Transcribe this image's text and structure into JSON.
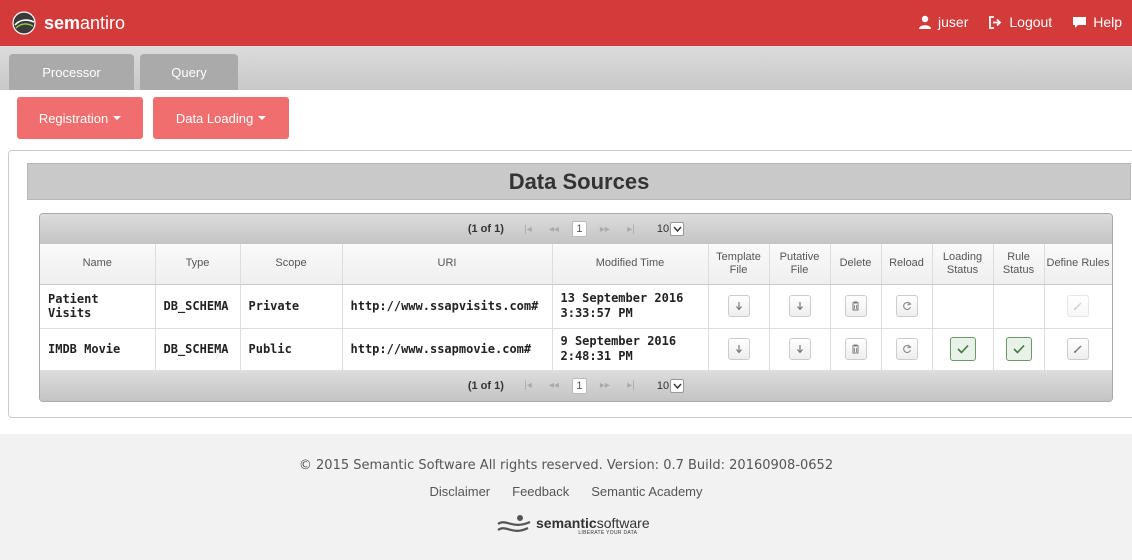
{
  "header": {
    "brand_bold": "sem",
    "brand_rest": "antiro",
    "user_label": "juser",
    "logout_label": "Logout",
    "help_label": "Help",
    "bar_color": "#d33a3a"
  },
  "tabs": [
    {
      "label": "Processor"
    },
    {
      "label": "Query"
    }
  ],
  "menus": [
    {
      "label": "Registration"
    },
    {
      "label": "Data Loading"
    }
  ],
  "panel": {
    "title": "Data Sources"
  },
  "paginator": {
    "report": "(1 of 1)",
    "current_page": "1",
    "rows_per_page": "10"
  },
  "table": {
    "columns": [
      "Name",
      "Type",
      "Scope",
      "URI",
      "Modified Time",
      "Template File",
      "Putative File",
      "Delete",
      "Reload",
      "Loading Status",
      "Rule Status",
      "Define Rules"
    ],
    "rows": [
      {
        "name": "Patient Visits",
        "type": "DB_SCHEMA",
        "scope": "Private",
        "uri": "http://www.ssapvisits.com#",
        "modified_date": "13 September 2016",
        "modified_time": "3:33:57 PM",
        "loading_status": "",
        "rule_status": "",
        "define_rules_enabled": false
      },
      {
        "name": "IMDB Movie",
        "type": "DB_SCHEMA",
        "scope": "Public",
        "uri": "http://www.ssapmovie.com#",
        "modified_date": "9 September 2016",
        "modified_time": "2:48:31 PM",
        "loading_status": "complete",
        "rule_status": "complete",
        "define_rules_enabled": true
      }
    ]
  },
  "footer": {
    "copyright": "© 2015 Semantic Software All rights reserved. Version: 0.7 Build: 20160908-0652",
    "links": [
      "Disclaimer",
      "Feedback",
      "Semantic Academy"
    ],
    "logo_bold": "semantic",
    "logo_rest": "software",
    "logo_tagline": "LIBERATE YOUR DATA"
  },
  "icons": {
    "brand": "globe-logo-icon",
    "user": "user-icon",
    "logout": "logout-icon",
    "help": "chat-bubble-icon",
    "template": "download-arrow-icon",
    "putative": "download-arrow-icon",
    "delete": "trash-icon",
    "reload": "refresh-icon",
    "status_ok": "checkmark-icon",
    "define_rules": "pencil-icon"
  }
}
